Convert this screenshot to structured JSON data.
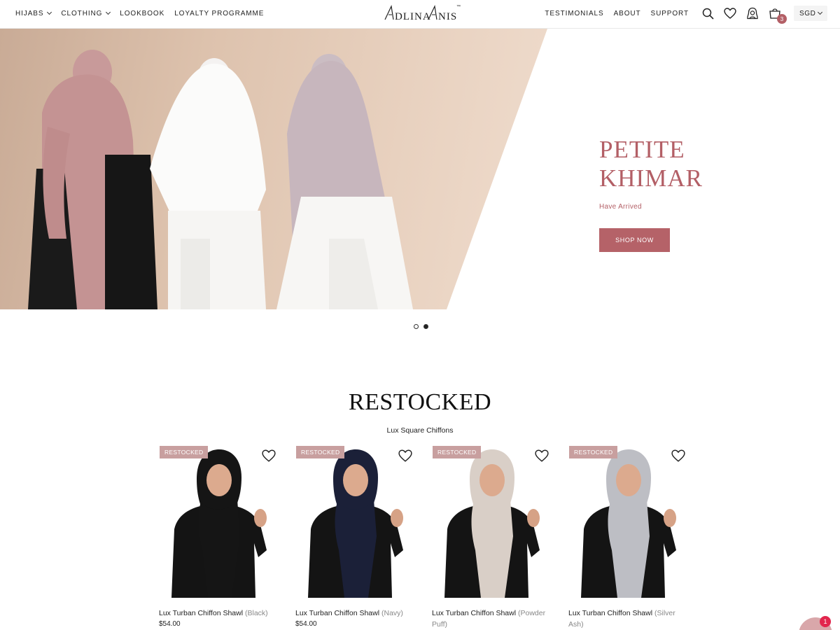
{
  "header": {
    "nav_left": [
      {
        "label": "HIJABS",
        "has_dropdown": true
      },
      {
        "label": "CLOTHING",
        "has_dropdown": true
      },
      {
        "label": "LOOKBOOK",
        "has_dropdown": false
      },
      {
        "label": "LOYALTY PROGRAMME",
        "has_dropdown": false
      }
    ],
    "logo_text": "ADLINA ANIS",
    "logo_tm": "™",
    "nav_right": [
      {
        "label": "TESTIMONIALS"
      },
      {
        "label": "ABOUT"
      },
      {
        "label": "SUPPORT"
      }
    ],
    "icons": [
      "search-icon",
      "heart-icon",
      "account-icon",
      "cart-icon"
    ],
    "cart_count": "3",
    "currency": "SGD"
  },
  "hero": {
    "title": "PETITE KHIMAR",
    "subtitle": "Have Arrived",
    "button_label": "SHOP NOW",
    "slides": 2,
    "active_slide": 2,
    "accent_color": "#b35f66"
  },
  "restocked": {
    "title": "RESTOCKED",
    "subtitle": "Lux Square Chiffons",
    "products": [
      {
        "badge": "RESTOCKED",
        "name": "Lux Turban Chiffon Shawl",
        "variant": "(Black)",
        "price": "$54.00",
        "scarf_color": "#151515"
      },
      {
        "badge": "RESTOCKED",
        "name": "Lux Turban Chiffon Shawl",
        "variant": "(Navy)",
        "price": "$54.00",
        "scarf_color": "#1b2038"
      },
      {
        "badge": "RESTOCKED",
        "name": "Lux Turban Chiffon Shawl",
        "variant": "(Powder Puff)",
        "price": "",
        "scarf_color": "#d9cfc7"
      },
      {
        "badge": "RESTOCKED",
        "name": "Lux Turban Chiffon Shawl",
        "variant": "(Silver Ash)",
        "price": "",
        "scarf_color": "#bdbec4"
      }
    ]
  },
  "chat": {
    "count": "1"
  }
}
